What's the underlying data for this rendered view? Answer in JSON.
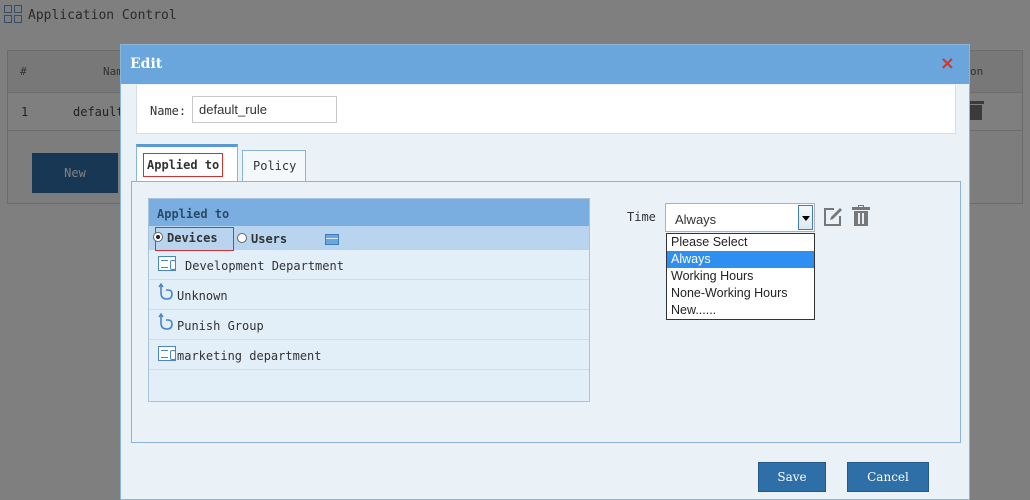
{
  "background": {
    "title": "Application Control",
    "table": {
      "headers": [
        "#",
        "Nam",
        "on"
      ],
      "row": {
        "index": "1",
        "name": "default"
      },
      "new_button": "New"
    }
  },
  "modal": {
    "title": "Edit",
    "close": "×",
    "name": {
      "label": "Name:",
      "value": "default_rule"
    },
    "tabs": [
      {
        "label": "Applied to",
        "active": true
      },
      {
        "label": "Policy",
        "active": false
      }
    ],
    "applied_to": {
      "header": "Applied to",
      "radio_devices": "Devices",
      "radio_users": "Users",
      "selected": "Devices",
      "items": [
        {
          "label": "Development Department",
          "icon": "department-icon"
        },
        {
          "label": "Unknown",
          "icon": "group-hook-icon"
        },
        {
          "label": "Punish Group",
          "icon": "group-hook-icon"
        },
        {
          "label": "marketing department",
          "icon": "department-icon"
        }
      ]
    },
    "time": {
      "label": "Time",
      "value": "Always",
      "options": [
        "Please Select",
        "Always",
        "Working Hours",
        "None-Working Hours",
        "New......"
      ],
      "highlighted": "Always"
    },
    "buttons": {
      "save": "Save",
      "cancel": "Cancel"
    }
  },
  "colors": {
    "header": "#6aa6dc",
    "button": "#2f6fa8",
    "highlight": "#2f8ff0",
    "close": "#e0301e",
    "focus_border": "#d03030"
  }
}
